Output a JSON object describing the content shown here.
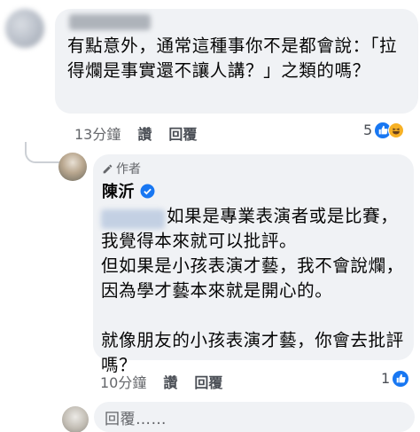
{
  "comment1": {
    "text": "有點意外，通常這種事你不是都會說：「拉得爛是事實還不讓人講？」之類的嗎？",
    "time": "13分鐘",
    "like_label": "讚",
    "reply_label": "回覆",
    "reaction_count": "5",
    "reaction_icons": [
      "like-icon",
      "haha-icon"
    ]
  },
  "reply": {
    "badge_label": "作者",
    "author_name": "陳沂",
    "text": "如果是專業表演者或是比賽，我覺得本來就可以批評。\n但如果是小孩表演才藝，我不會說爛，因為學才藝本來就是開心的。\n\n就像朋友的小孩表演才藝，你會去批評嗎？",
    "time": "10分鐘",
    "like_label": "讚",
    "reply_label": "回覆",
    "reaction_count": "1",
    "reaction_icons": [
      "like-icon"
    ]
  },
  "composer": {
    "placeholder": "回覆……"
  },
  "colors": {
    "bubble": "#f0f2f5",
    "meta": "#65676b",
    "like": "#1877f2",
    "haha": "#f7b125"
  }
}
